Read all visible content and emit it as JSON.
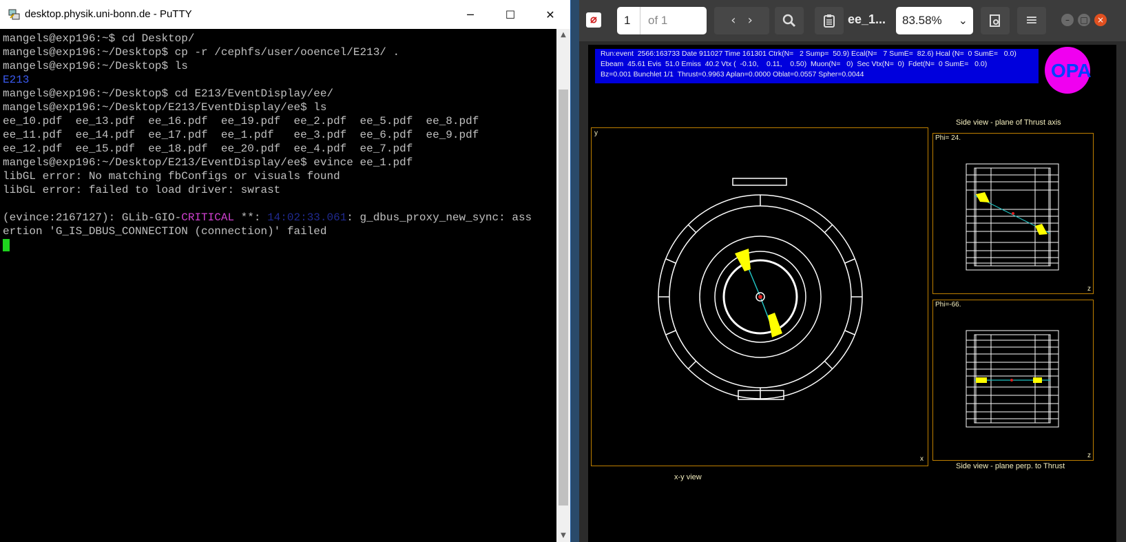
{
  "putty": {
    "title": "desktop.physik.uni-bonn.de - PuTTY",
    "controls": {
      "minimize": "─",
      "maximize": "☐",
      "close": "✕"
    },
    "lines": [
      {
        "text": "mangels@exp196:~$ cd Desktop/"
      },
      {
        "text": "mangels@exp196:~/Desktop$ cp -r /cephfs/user/ooencel/E213/ ."
      },
      {
        "text": "mangels@exp196:~/Desktop$ ls"
      },
      {
        "text": "E213"
      },
      {
        "text": "mangels@exp196:~/Desktop$ cd E213/EventDisplay/ee/"
      },
      {
        "text": "mangels@exp196:~/Desktop/E213/EventDisplay/ee$ ls"
      },
      {
        "text": "ee_10.pdf  ee_13.pdf  ee_16.pdf  ee_19.pdf  ee_2.pdf  ee_5.pdf  ee_8.pdf"
      },
      {
        "text": "ee_11.pdf  ee_14.pdf  ee_17.pdf  ee_1.pdf   ee_3.pdf  ee_6.pdf  ee_9.pdf"
      },
      {
        "text": "ee_12.pdf  ee_15.pdf  ee_18.pdf  ee_20.pdf  ee_4.pdf  ee_7.pdf"
      },
      {
        "text": "mangels@exp196:~/Desktop/E213/EventDisplay/ee$ evince ee_1.pdf"
      },
      {
        "text": "libGL error: No matching fbConfigs or visuals found"
      },
      {
        "text": "libGL error: failed to load driver: swrast"
      },
      {
        "text": ""
      }
    ],
    "warn": {
      "prefix": "(evince:2167127): GLib-GIO-",
      "level": "CRITICAL",
      "sep": " **: ",
      "time": "14:02:33.061",
      "msg1": ": g_dbus_proxy_new_sync: ass",
      "msg2": "ertion 'G_IS_DBUS_CONNECTION (connection)' failed"
    }
  },
  "evince": {
    "page_input": "1",
    "page_of": "of 1",
    "title": "ee_1...",
    "zoom": "83.58%",
    "header_colors": {
      "bg": "#3c3c3c"
    }
  },
  "event": {
    "info": [
      "Run:event  2566:163733 Date 911027 Time 161301 Ctrk(N=   2 Sump=  50.9) Ecal(N=   7 SumE=  82.6) Hcal (N=  0 SumE=   0.0)",
      "Ebeam  45.61 Evis  51.0 Emiss  40.2 Vtx (  -0.10,    0.11,    0.50)  Muon(N=   0)  Sec Vtx(N=  0)  Fdet(N=  0 SumE=   0.0)",
      "Bz=0.001 Bunchlet 1/1  Thrust=0.9963 Aplan=0.0000 Oblat=0.0557 Spher=0.0044"
    ],
    "logo": "OPAL",
    "side_title_top": "Side view - plane of Thrust axis",
    "side_title_bottom": "Side view - plane perp. to Thrust",
    "xy_caption": "x-y view",
    "axis_y": "y",
    "axis_x": "x",
    "axis_z": "z",
    "phi_top": "Phi= 24.",
    "phi_bottom": "Phi=-66."
  }
}
